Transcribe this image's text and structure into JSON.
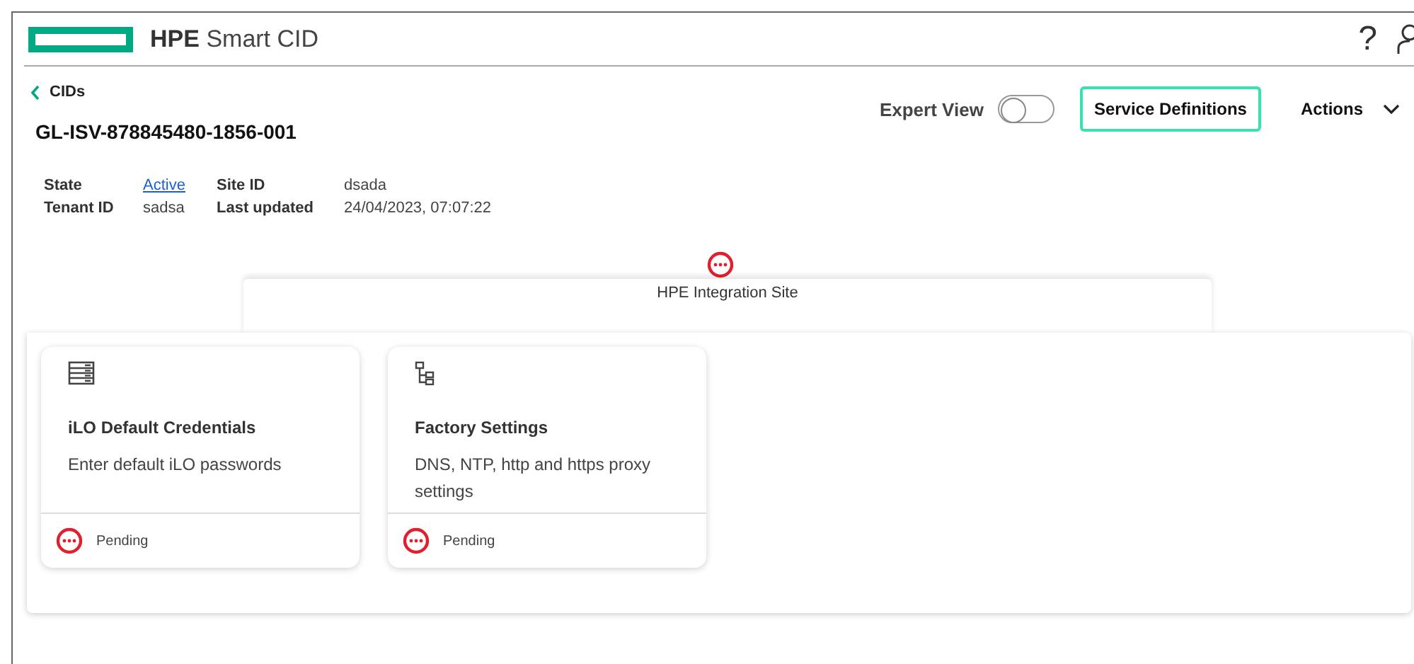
{
  "header": {
    "app_name_bold": "HPE",
    "app_name": "Smart CID",
    "help": "?"
  },
  "back_link": "CIDs",
  "title": "GL-ISV-878845480-1856-001",
  "expert_view": {
    "label": "Expert View",
    "on": false
  },
  "service_definitions": "Service Definitions",
  "actions": "Actions",
  "details": [
    {
      "label": "State",
      "value": "Active",
      "kind": "link"
    },
    {
      "label": "Site ID",
      "value": "dsada",
      "kind": "text"
    },
    {
      "label": "Tenant ID",
      "value": "sadsa",
      "kind": "text"
    },
    {
      "label": "Last updated",
      "value": "24/04/2023, 07:07:22",
      "kind": "text"
    }
  ],
  "site": {
    "name": "HPE Integration Site",
    "status": {
      "kind": "pending"
    }
  },
  "cards": [
    {
      "title": "iLO Default Credentials",
      "description": "Enter default iLO passwords",
      "status": {
        "kind": "pending",
        "text": "Pending"
      }
    },
    {
      "title": "Factory Settings",
      "description": "DNS, NTP, http and https proxy settings",
      "status": {
        "kind": "pending",
        "text": "Pending"
      }
    }
  ]
}
